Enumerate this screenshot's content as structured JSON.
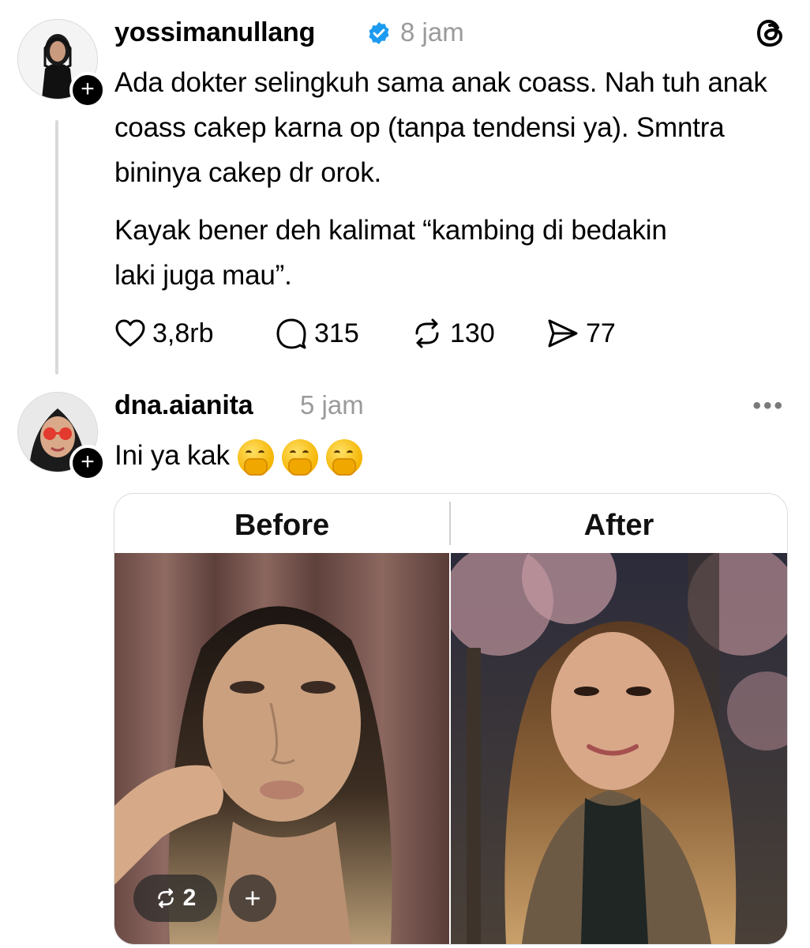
{
  "post": {
    "username": "yossimanullang",
    "time": "8 jam",
    "paragraphs": [
      "Ada dokter selingkuh sama anak coass. Nah tuh anak coass cakep karna op (tanpa tendensi ya). Smntra bininya cakep dr orok.",
      "Kayak bener deh kalimat “kambing di bedakin laki juga mau”."
    ],
    "likes": "3,8rb",
    "replies": "315",
    "reposts": "130",
    "shares": "77"
  },
  "reply": {
    "username": "dna.aianita",
    "time": "5 jam",
    "text": "Ini ya kak",
    "emojis": [
      "face-with-hand-over-mouth",
      "face-with-hand-over-mouth",
      "face-with-hand-over-mouth"
    ],
    "media": {
      "left_label": "Before",
      "right_label": "After",
      "repost_count": "2",
      "add_label": "+"
    }
  },
  "icons": {
    "verified": "verified-badge-icon",
    "app": "threads-logo-icon",
    "like": "heart-icon",
    "reply": "speech-bubble-icon",
    "repost": "repost-icon",
    "share": "send-icon",
    "more": "more-icon"
  },
  "colors": {
    "verified": "#1d9bf0",
    "muted": "#9a9a9a"
  }
}
